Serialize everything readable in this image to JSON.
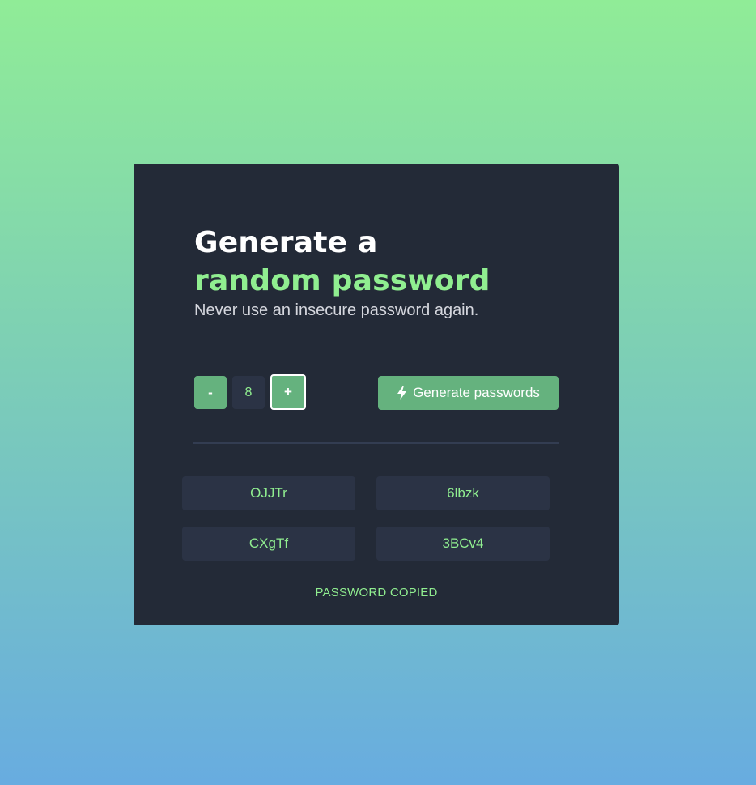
{
  "header": {
    "title_line1": "Generate a",
    "title_line2": "random password",
    "subtitle": "Never use an insecure password again."
  },
  "controls": {
    "decrement_label": "-",
    "length_value": "8",
    "increment_label": "+",
    "generate_label": "Generate passwords",
    "generate_icon": "bolt-icon"
  },
  "passwords": [
    "OJJTr",
    "6lbzk",
    "CXgTf",
    "3BCv4"
  ],
  "status": {
    "message": "PASSWORD COPIED"
  },
  "colors": {
    "accent": "#90ee90",
    "button": "#65b27e",
    "card": "#232a37",
    "field": "#2b3345"
  }
}
